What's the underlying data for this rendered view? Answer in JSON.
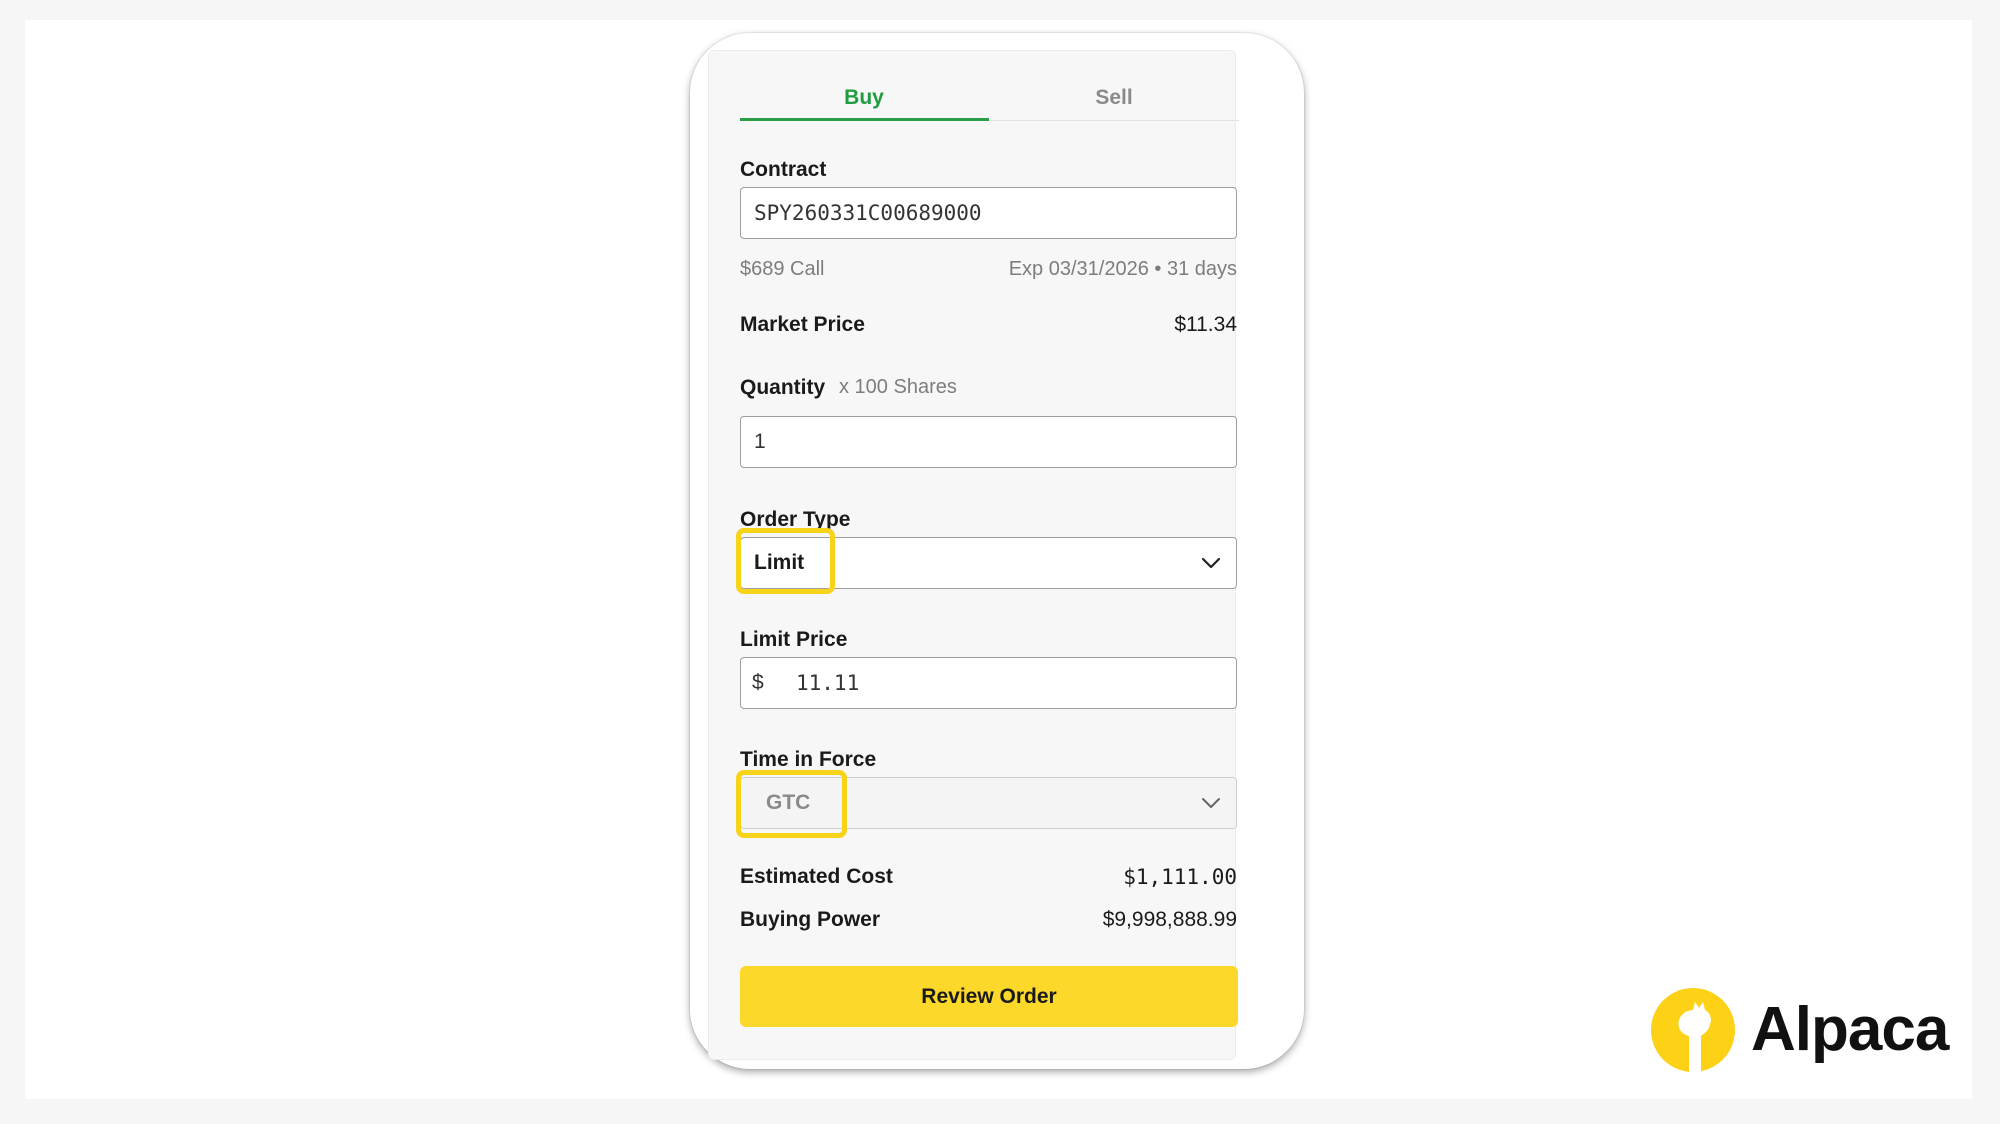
{
  "tabs": {
    "buy": "Buy",
    "sell": "Sell"
  },
  "contract": {
    "label": "Contract",
    "value": "SPY260331C00689000",
    "strike_desc": "$689 Call",
    "expiry_desc": "Exp 03/31/2026 • 31 days"
  },
  "market_price": {
    "label": "Market Price",
    "value": "$11.34"
  },
  "quantity": {
    "label": "Quantity",
    "multiplier": "x 100 Shares",
    "value": "1"
  },
  "order_type": {
    "label": "Order Type",
    "value": "Limit"
  },
  "limit_price": {
    "label": "Limit Price",
    "currency": "$",
    "value": "11.11"
  },
  "time_in_force": {
    "label": "Time in Force",
    "value": "GTC"
  },
  "estimated_cost": {
    "label": "Estimated Cost",
    "value": "$1,111.00"
  },
  "buying_power": {
    "label": "Buying Power",
    "value": "$9,998,888.99"
  },
  "review_button": "Review Order",
  "brand": {
    "name": "Alpaca",
    "logo_icon": "alpaca-logo-icon"
  },
  "colors": {
    "accent_green": "#1f9d3e",
    "button_yellow": "#fbd82a",
    "highlight_yellow": "#f7d319",
    "logo_yellow": "#fcd116"
  }
}
